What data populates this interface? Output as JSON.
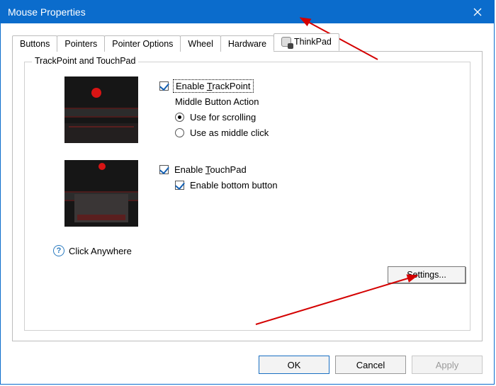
{
  "window": {
    "title": "Mouse Properties"
  },
  "tabs": [
    {
      "label": "Buttons"
    },
    {
      "label": "Pointers"
    },
    {
      "label": "Pointer Options"
    },
    {
      "label": "Wheel"
    },
    {
      "label": "Hardware"
    },
    {
      "label": "ThinkPad",
      "active": true,
      "icon": "trackpad-icon"
    }
  ],
  "group": {
    "title": "TrackPoint and TouchPad",
    "trackpoint": {
      "enable_label_pre": "Enable ",
      "enable_u": "T",
      "enable_post": "rackPoint",
      "middle_label": "Middle Button Action",
      "radio_scroll": "Use for scrolling",
      "radio_middle": "Use as middle click"
    },
    "touchpad": {
      "enable_label": "Enable TouchPad",
      "enable_u": "T",
      "bottom_label": "Enable bottom button"
    },
    "click_anywhere": "Click Anywhere",
    "settings_label": "Settings...",
    "settings_u": "n"
  },
  "buttons": {
    "ok": "OK",
    "cancel": "Cancel",
    "apply": "Apply"
  }
}
